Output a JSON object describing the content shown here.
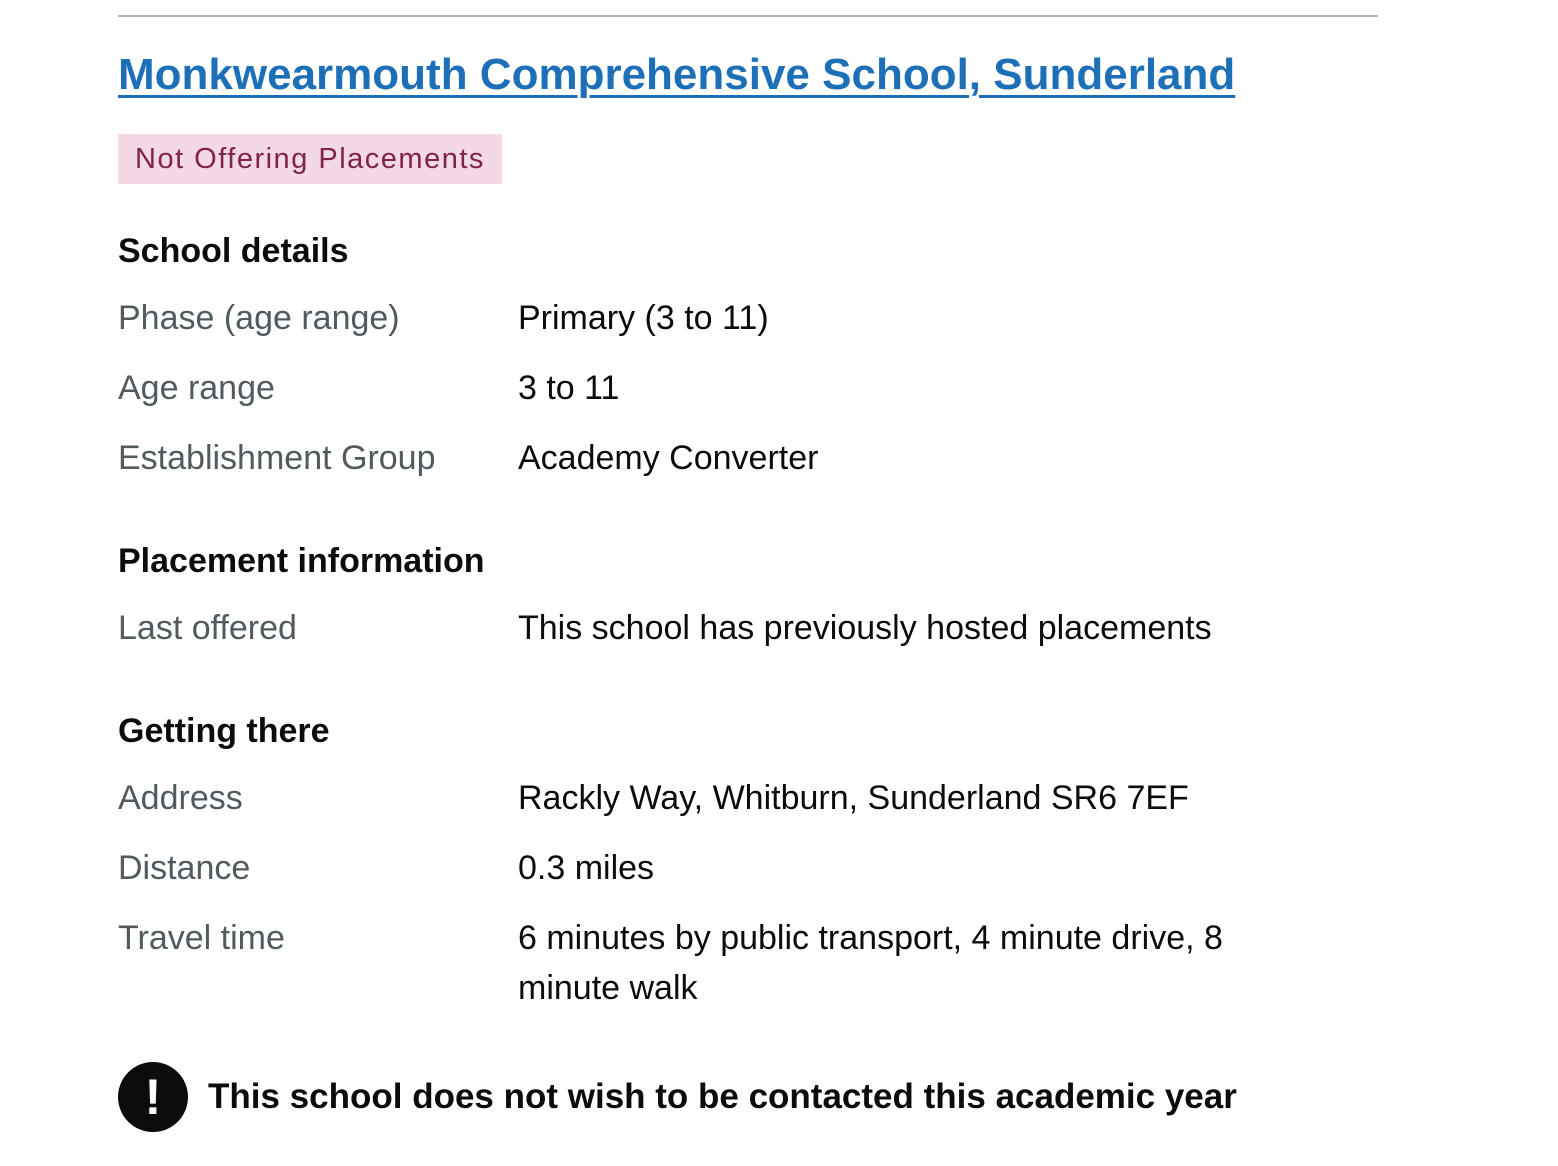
{
  "school": {
    "name": "Monkwearmouth Comprehensive School, Sunderland",
    "status_tag": "Not Offering Placements"
  },
  "school_details": {
    "heading": "School details",
    "rows": [
      {
        "key": "Phase (age range)",
        "value": "Primary (3 to 11)"
      },
      {
        "key": "Age range",
        "value": "3 to 11"
      },
      {
        "key": "Establishment Group",
        "value": "Academy Converter"
      }
    ]
  },
  "placement_information": {
    "heading": "Placement information",
    "rows": [
      {
        "key": "Last offered",
        "value": "This school has previously hosted placements"
      }
    ]
  },
  "getting_there": {
    "heading": "Getting there",
    "rows": [
      {
        "key": "Address",
        "value": "Rackly Way, Whitburn, Sunderland SR6 7EF"
      },
      {
        "key": "Distance",
        "value": "0.3 miles"
      },
      {
        "key": "Travel time",
        "value": "6 minutes by public transport, 4 minute drive, 8 minute walk"
      }
    ]
  },
  "warning": {
    "icon_glyph": "!",
    "icon": "exclamation-icon",
    "text": "This school does not wish to be contacted this academic year"
  },
  "colors": {
    "link": "#1d70b8",
    "tag_background": "#f3d9e5",
    "tag_text": "#80224d",
    "key_text": "#505a5f",
    "body_text": "#0b0c0c",
    "divider": "#b1b4b6"
  }
}
